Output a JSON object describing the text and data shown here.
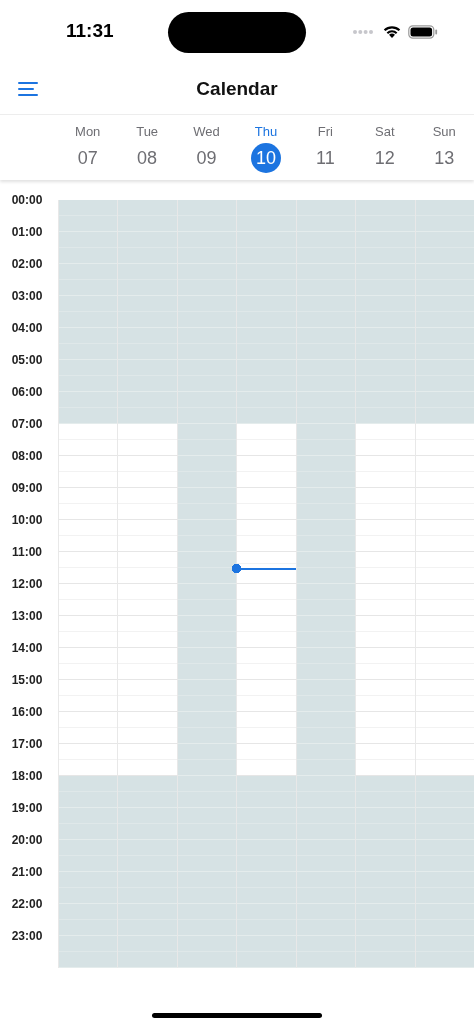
{
  "status_bar": {
    "time": "11:31"
  },
  "header": {
    "title": "Calendar"
  },
  "days": [
    {
      "weekday": "Mon",
      "date": "07",
      "selected": false,
      "off_day": false
    },
    {
      "weekday": "Tue",
      "date": "08",
      "selected": false,
      "off_day": false
    },
    {
      "weekday": "Wed",
      "date": "09",
      "selected": false,
      "off_day": true
    },
    {
      "weekday": "Thu",
      "date": "10",
      "selected": true,
      "off_day": false
    },
    {
      "weekday": "Fri",
      "date": "11",
      "selected": false,
      "off_day": true
    },
    {
      "weekday": "Sat",
      "date": "12",
      "selected": false,
      "off_day": false
    },
    {
      "weekday": "Sun",
      "date": "13",
      "selected": false,
      "off_day": false
    }
  ],
  "hours": [
    {
      "label": "00:00",
      "off_hours": true
    },
    {
      "label": "01:00",
      "off_hours": true
    },
    {
      "label": "02:00",
      "off_hours": true
    },
    {
      "label": "03:00",
      "off_hours": true
    },
    {
      "label": "04:00",
      "off_hours": true
    },
    {
      "label": "05:00",
      "off_hours": true
    },
    {
      "label": "06:00",
      "off_hours": true
    },
    {
      "label": "07:00",
      "off_hours": false
    },
    {
      "label": "08:00",
      "off_hours": false
    },
    {
      "label": "09:00",
      "off_hours": false
    },
    {
      "label": "10:00",
      "off_hours": false
    },
    {
      "label": "11:00",
      "off_hours": false
    },
    {
      "label": "12:00",
      "off_hours": false
    },
    {
      "label": "13:00",
      "off_hours": false
    },
    {
      "label": "14:00",
      "off_hours": false
    },
    {
      "label": "15:00",
      "off_hours": false
    },
    {
      "label": "16:00",
      "off_hours": false
    },
    {
      "label": "17:00",
      "off_hours": false
    },
    {
      "label": "18:00",
      "off_hours": true
    },
    {
      "label": "19:00",
      "off_hours": true
    },
    {
      "label": "20:00",
      "off_hours": true
    },
    {
      "label": "21:00",
      "off_hours": true
    },
    {
      "label": "22:00",
      "off_hours": true
    },
    {
      "label": "23:00",
      "off_hours": true
    }
  ],
  "now_line": {
    "level": 0.479
  }
}
